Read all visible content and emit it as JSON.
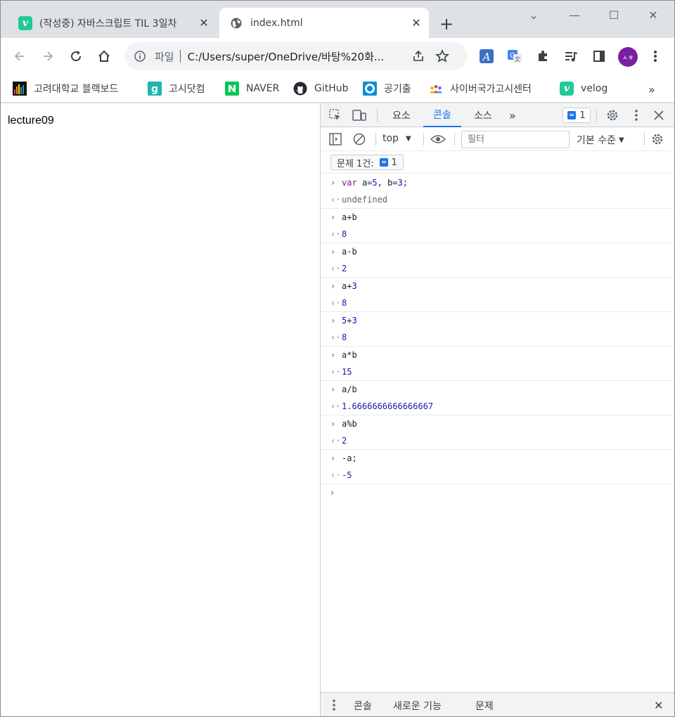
{
  "tabs": [
    {
      "title": "(작성중) 자바스크립트 TIL 3일차",
      "favicon": "velog-icon",
      "active": false
    },
    {
      "title": "index.html",
      "favicon": "globe-icon",
      "active": true
    }
  ],
  "window": {
    "minimize": "—",
    "maximize": "☐",
    "close": "✕",
    "tab_search": "⌄"
  },
  "omnibox": {
    "scheme": "파일",
    "url": "C:/Users/super/OneDrive/바탕%20화..."
  },
  "profile": {
    "initials": "ㅅㅎ",
    "color": "#7b1fa2"
  },
  "bookmarks": [
    {
      "label": "고려대학교 블랙보드",
      "icon": "blackboard-icon"
    },
    {
      "label": "고시닷컴",
      "icon": "gosi-icon"
    },
    {
      "label": "NAVER",
      "icon": "naver-icon"
    },
    {
      "label": "GitHub",
      "icon": "github-icon"
    },
    {
      "label": "공기출",
      "icon": "gonggichul-icon"
    },
    {
      "label": "사이버국가고시센터",
      "icon": "cyber-exam-icon"
    },
    {
      "label": "velog",
      "icon": "velog-icon"
    }
  ],
  "bookmarks_more": "»",
  "page": {
    "text": "lecture09"
  },
  "devtools": {
    "tabs": [
      "요소",
      "콘솔",
      "소스"
    ],
    "active_tab": "콘솔",
    "more_tabs": "»",
    "issues_count": "1",
    "context": "top",
    "filter_placeholder": "필터",
    "level": "기본 수준",
    "issues_label": "문제 1건:",
    "issues_pill_count": "1",
    "drawer": [
      "콘솔",
      "새로운 기능",
      "문제"
    ],
    "accent": "#1a73e8"
  },
  "console": [
    {
      "input": "var a=5, b=3;",
      "output": "undefined"
    },
    {
      "input": "a+b",
      "output": "8"
    },
    {
      "input": "a-b",
      "output": "2"
    },
    {
      "input": "a+3",
      "output": "8"
    },
    {
      "input": "5+3",
      "output": "8"
    },
    {
      "input": "a*b",
      "output": "15"
    },
    {
      "input": "a/b",
      "output": "1.6666666666666667"
    },
    {
      "input": "a%b",
      "output": "2"
    },
    {
      "input": "-a;",
      "output": "-5"
    }
  ]
}
